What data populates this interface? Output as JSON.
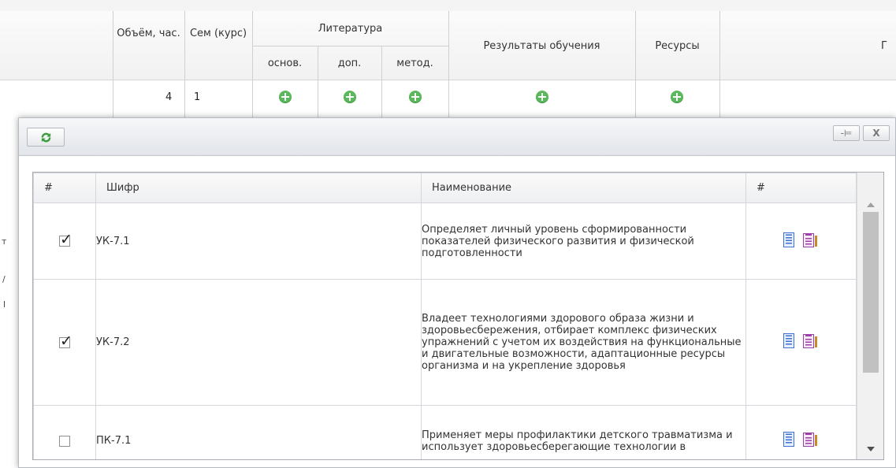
{
  "bg_table": {
    "headers": {
      "volume": "Объём, час.",
      "sem": "Сем (курс)",
      "literature": "Литература",
      "lit_main": "основ.",
      "lit_add": "доп.",
      "lit_method": "метод.",
      "results": "Результаты обучения",
      "resources": "Ресурсы",
      "cut_right": "Г"
    },
    "row": {
      "volume": "4",
      "sem": "1"
    },
    "left_fragments": [
      "т",
      "/",
      "l"
    ]
  },
  "popup": {
    "toolbar": {
      "refresh_icon": "refresh-icon",
      "pin_icon": "pin-icon",
      "pin_glyph": "-⊨",
      "close_glyph": "X"
    },
    "table": {
      "columns": [
        "#",
        "Шифр",
        "Наименование",
        "#"
      ],
      "rows": [
        {
          "checked": true,
          "code": "УК-7.1",
          "name": "Определяет личный уровень сформированности показателей физического развития и физической подготовленности"
        },
        {
          "checked": true,
          "code": "УК-7.2",
          "name": "Владеет технологиями здорового образа жизни и здоровьесбережения, отбирает комплекс физических упражнений с учетом их воздействия на функциональные и двигательные возможности, адаптационные ресурсы организма и на укрепление здоровья"
        },
        {
          "checked": false,
          "code": "ПК-7.1",
          "name": "Применяет меры профилактики детского травматизма и использует здоровьесберегающие технологии в"
        }
      ]
    },
    "colors": {
      "plus_green": "#5cb85c",
      "icon_blue": "#3e6fd1",
      "icon_purple": "#9c3fa8"
    }
  }
}
